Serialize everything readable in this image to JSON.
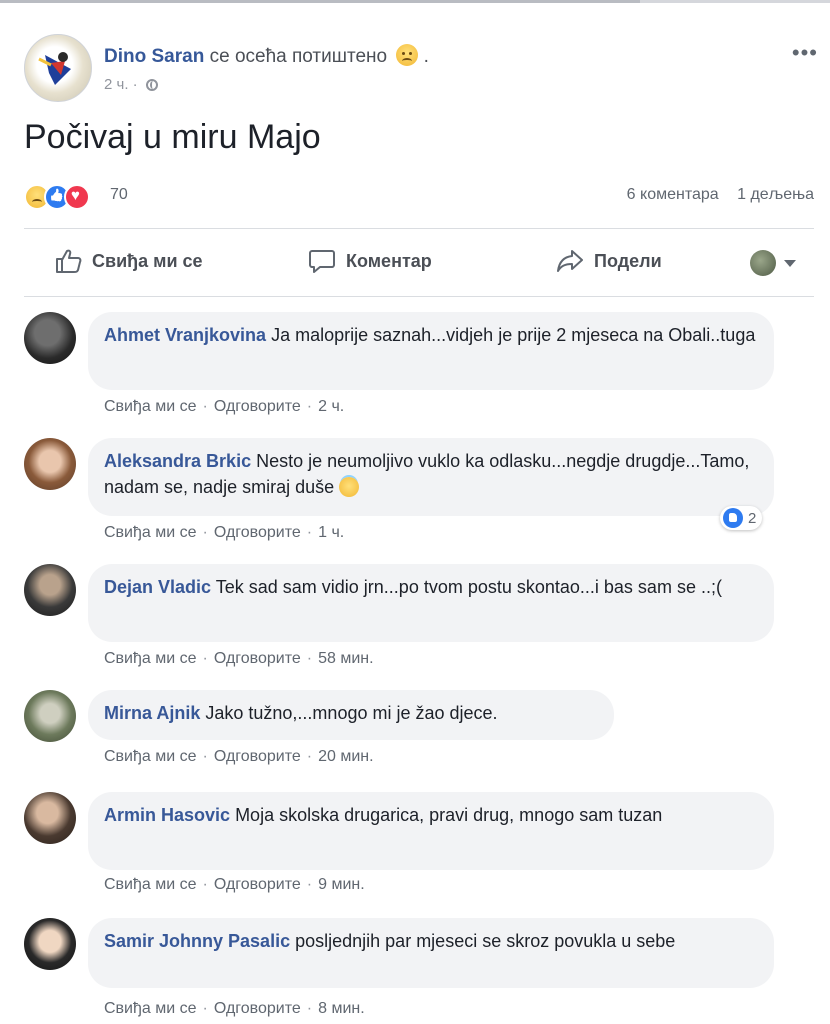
{
  "post": {
    "author": "Dino Saran",
    "feeling": "се осећа потиштено",
    "feeling_suffix": ".",
    "time": "2 ч. ·",
    "text": "Počivaj u miru Majo",
    "reaction_count": "70",
    "comments_count": "6 коментара",
    "shares_count": "1 дељења"
  },
  "actions": {
    "like": "Свиђа ми се",
    "comment": "Коментар",
    "share": "Подели"
  },
  "comment_actions": {
    "like": "Свиђа ми се",
    "reply": "Одговорите",
    "dot": "·"
  },
  "comments": [
    {
      "name": "Ahmet Vranjkovina",
      "text": "Ja maloprije saznah...vidjeh je prije 2 mjeseca na Obali..tuga",
      "time": "2 ч."
    },
    {
      "name": "Aleksandra Brkic",
      "text": "Nesto je neumoljivo vuklo ka odlasku...negdje drugdje...Tamo, nadam se, nadje smiraj duše",
      "time": "1 ч.",
      "likes": "2"
    },
    {
      "name": "Dejan Vladic",
      "text": "Tek sad sam vidio jrn...po tvom postu skontao...i bas sam se ..;(",
      "time": "58 мин."
    },
    {
      "name": "Mirna Ajnik",
      "text": "Jako tužno,...mnogo mi je žao djece.",
      "time": "20 мин."
    },
    {
      "name": "Armin Hasovic",
      "text": "Moja skolska drugarica, pravi drug, mnogo sam tuzan",
      "time": "9 мин."
    },
    {
      "name": "Samir Johnny Pasalic",
      "text": "posljednjih par mjeseci se skroz povukla u sebe",
      "time": "8 мин."
    }
  ],
  "icons": {
    "feeling": "sad-face-emoji",
    "privacy": "globe-icon",
    "menu": "more-icon",
    "reactions": [
      "sad-reaction-icon",
      "like-reaction-icon",
      "love-reaction-icon"
    ]
  },
  "colors": {
    "name_link": "#385898",
    "bubble": "#f2f3f5",
    "meta": "#606770",
    "like_blue": "#2e7bf0",
    "love_red": "#f0384f"
  }
}
